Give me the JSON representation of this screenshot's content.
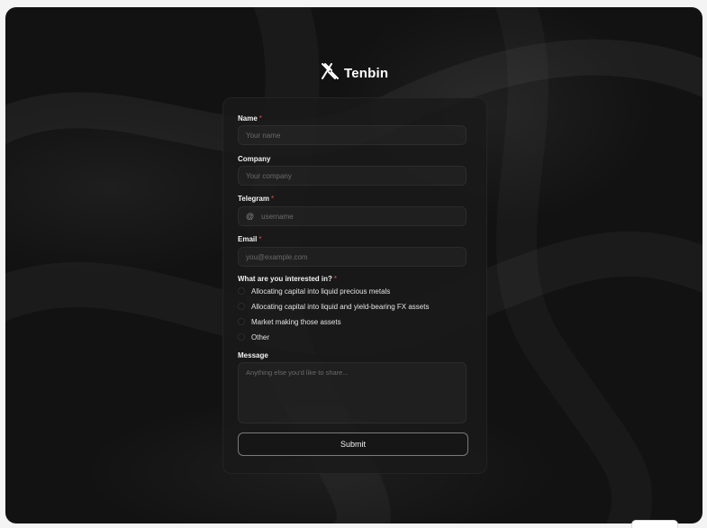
{
  "brand": {
    "name": "Tenbin",
    "logo_icon": "tenbin-logo-icon"
  },
  "form": {
    "fields": {
      "name": {
        "label": "Name",
        "required_mark": "*",
        "placeholder": "Your name"
      },
      "company": {
        "label": "Company",
        "placeholder": "Your company"
      },
      "telegram": {
        "label": "Telegram",
        "required_mark": "*",
        "prefix": "@",
        "placeholder": "username"
      },
      "email": {
        "label": "Email",
        "required_mark": "*",
        "placeholder": "you@example.com"
      }
    },
    "interests": {
      "label": "What are you interested in?",
      "required_mark": "*",
      "options": [
        "Allocating capital into liquid precious metals",
        "Allocating capital into liquid and yield-bearing FX assets",
        "Market making those assets",
        "Other"
      ]
    },
    "message": {
      "label": "Message",
      "placeholder": "Anything else you'd like to share..."
    },
    "submit_label": "Submit"
  },
  "colors": {
    "background": "#121212",
    "card": "#1a1a1a",
    "required": "#d9534f",
    "text": "#f2f2f2"
  }
}
